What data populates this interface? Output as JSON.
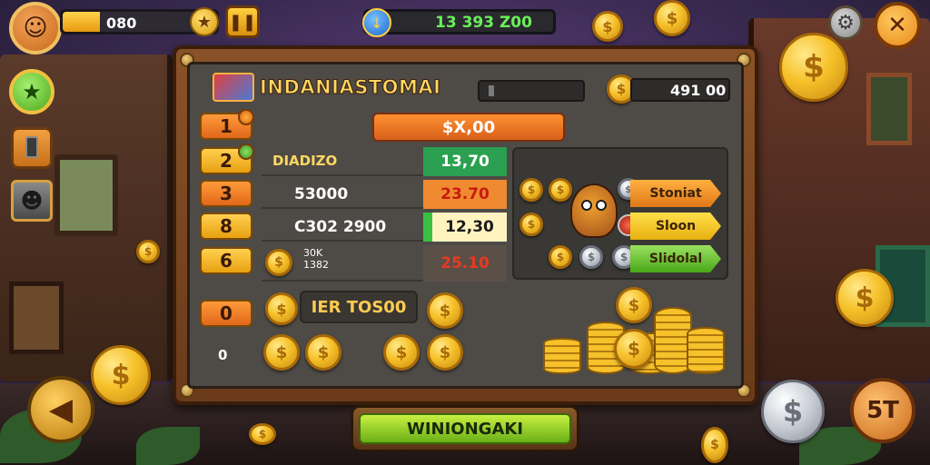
{
  "hud": {
    "level_value": "080",
    "level_progress": 0.24,
    "currency_value": "13  393 Z00"
  },
  "panel": {
    "title": "INDANIASTOMAI",
    "coin_total": "491 00",
    "header_value": "$X,00"
  },
  "ranks": [
    "1",
    "2",
    "3",
    "8",
    "6",
    "0"
  ],
  "table": {
    "header": {
      "label": "DIADIZO",
      "value": "13,70"
    },
    "rows": [
      {
        "label": "53000",
        "value": "23.70"
      },
      {
        "label": "C302 2900",
        "value": "12,30"
      },
      {
        "label": "30K\n1382",
        "value": "25.10"
      }
    ]
  },
  "shop": {
    "items": [
      {
        "label": "Stoniat",
        "style": "orange"
      },
      {
        "label": "Sloon",
        "style": "yellow"
      },
      {
        "label": "Slidolal",
        "style": "green"
      }
    ]
  },
  "bottom": {
    "label": "IER TOS00",
    "zero_text": "0"
  },
  "win_button": {
    "label": "WINIONGAKI"
  },
  "bottom_right_button": {
    "label": "5T"
  },
  "icons": {
    "avatar": "avatar-icon",
    "star": "star-icon",
    "pause": "pause-icon",
    "currency": "currency-icon",
    "settings": "gear-icon",
    "close": "close-icon",
    "back": "back-arrow-icon"
  },
  "colors": {
    "accent_orange": "#e07818",
    "accent_green": "#6ab018",
    "gold": "#f6c12a"
  }
}
